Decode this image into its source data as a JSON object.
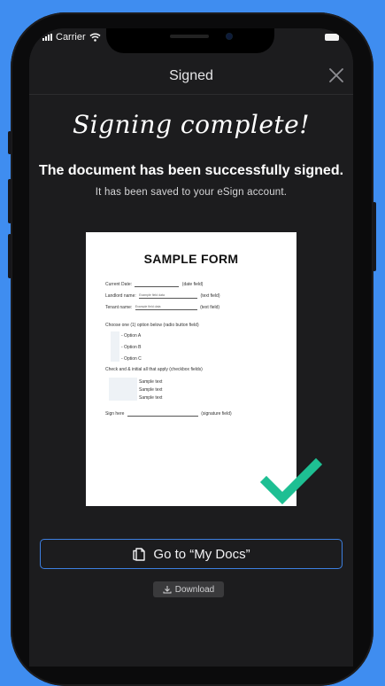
{
  "status_bar": {
    "carrier": "Carrier"
  },
  "nav": {
    "title": "Signed",
    "close_icon": "close-icon"
  },
  "message": {
    "headline": "Signing complete!",
    "subheadline": "The document has been successfully signed.",
    "note": "It has been saved to your eSign account."
  },
  "document": {
    "title": "SAMPLE FORM",
    "current_date_label": "Current Date:",
    "date_field_note": "(date field)",
    "landlord_label": "Landlord name:",
    "landlord_value": "Example field data",
    "text_field_note_1": "(text field)",
    "tenant_label": "Tenant name:",
    "tenant_value": "Example field data",
    "text_field_note_2": "(text field)",
    "radio_prompt": "Choose one (1) option below (radio button field)",
    "options": [
      "- Option A",
      "- Option B",
      "- Option C"
    ],
    "checkbox_prompt": "Check and & initial all that apply (checkbox fields)",
    "samples": [
      "Sample text",
      "Sample text",
      "Sample text"
    ],
    "sign_label": "Sign here",
    "signature_note": "(signature field)"
  },
  "actions": {
    "go_to_docs": "Go to “My Docs”",
    "go_to_docs_icon": "documents-icon",
    "download": "Download",
    "download_icon": "download-icon"
  },
  "colors": {
    "background": "#3f8df0",
    "screen": "#1c1c1e",
    "accent_border": "#3d7fe0",
    "checkmark": "#1ebf93"
  }
}
